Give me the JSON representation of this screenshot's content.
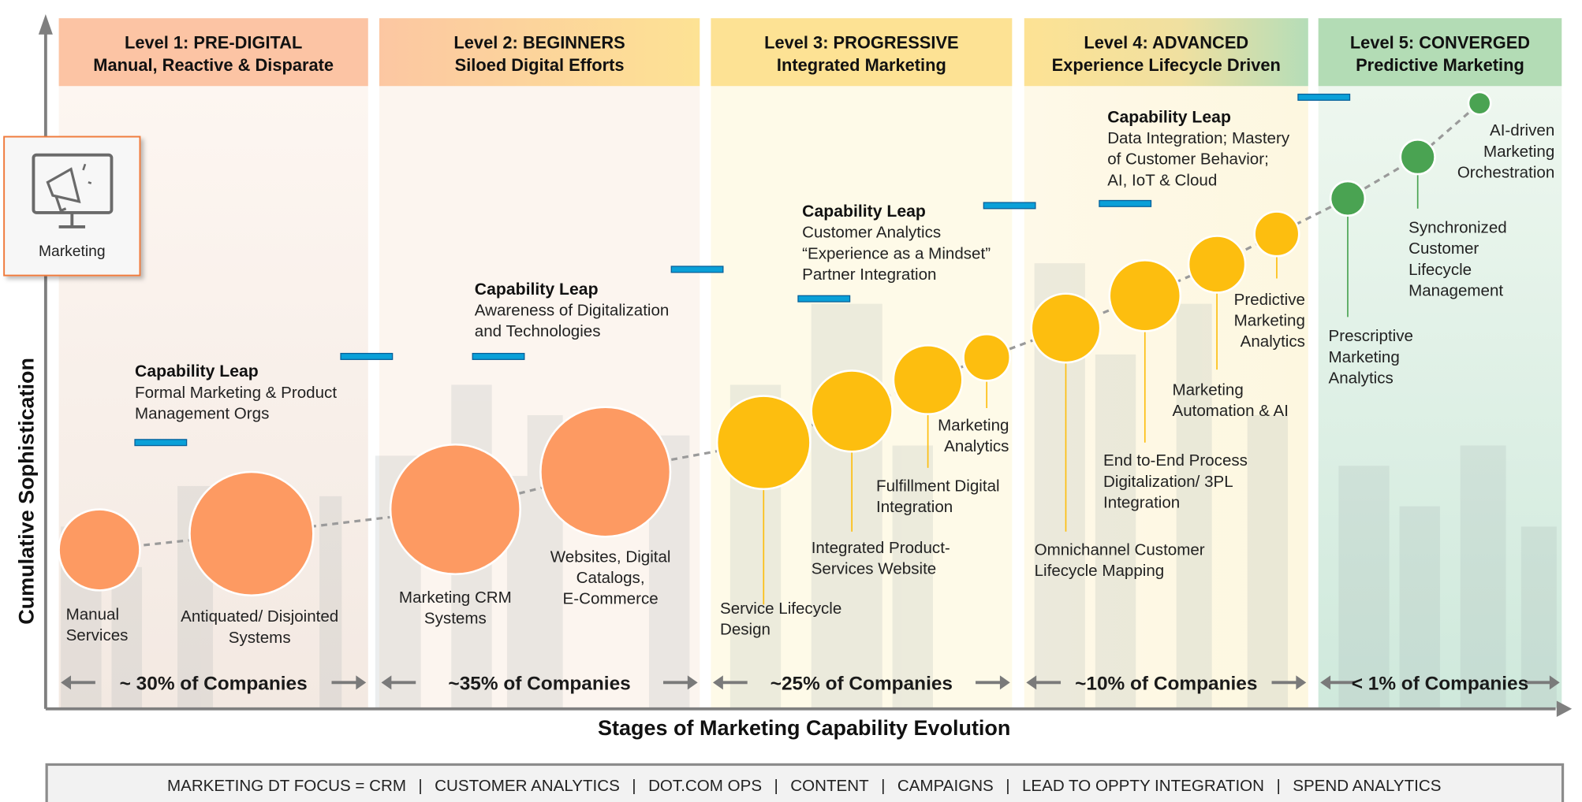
{
  "axes": {
    "y_label": "Cumulative Sophistication",
    "x_label": "Stages of Marketing Capability Evolution"
  },
  "marketing_card": {
    "label": "Marketing",
    "icon": "megaphone-monitor-icon"
  },
  "levels": [
    {
      "title": "Level 1: PRE-DIGITAL",
      "subtitle": "Manual, Reactive & Disparate",
      "share": "~ 30% of Companies"
    },
    {
      "title": "Level 2: BEGINNERS",
      "subtitle": "Siloed Digital Efforts",
      "share": "~35% of Companies"
    },
    {
      "title": "Level 3: PROGRESSIVE",
      "subtitle": "Integrated Marketing",
      "share": "~25% of Companies"
    },
    {
      "title": "Level 4: ADVANCED",
      "subtitle": "Experience Lifecycle Driven",
      "share": "~10% of Companies"
    },
    {
      "title": "Level 5: CONVERGED",
      "subtitle": "Predictive Marketing",
      "share": "< 1% of Companies"
    }
  ],
  "capability_leaps": [
    {
      "title": "Capability Leap",
      "lines": [
        "Formal Marketing & Product",
        "Management Orgs"
      ]
    },
    {
      "title": "Capability Leap",
      "lines": [
        "Awareness of Digitalization",
        "and Technologies"
      ]
    },
    {
      "title": "Capability Leap",
      "lines": [
        "Customer Analytics",
        "“Experience as a Mindset”",
        "Partner Integration"
      ]
    },
    {
      "title": "Capability Leap",
      "lines": [
        "Data Integration; Mastery",
        "of Customer Behavior;",
        "AI, IoT & Cloud"
      ]
    }
  ],
  "milestones": [
    {
      "lines": [
        "Manual",
        "Services"
      ],
      "level": 1
    },
    {
      "lines": [
        "Antiquated/ Disjointed",
        "Systems"
      ],
      "level": 1
    },
    {
      "lines": [
        "Marketing CRM",
        "Systems"
      ],
      "level": 2
    },
    {
      "lines": [
        "Websites, Digital",
        "Catalogs,",
        "E-Commerce"
      ],
      "level": 2
    },
    {
      "lines": [
        "Service Lifecycle",
        "Design"
      ],
      "level": 3
    },
    {
      "lines": [
        "Integrated Product-",
        "Services Website"
      ],
      "level": 3
    },
    {
      "lines": [
        "Fulfillment Digital",
        "Integration"
      ],
      "level": 3
    },
    {
      "lines": [
        "Marketing",
        "Analytics"
      ],
      "level": 3
    },
    {
      "lines": [
        "Omnichannel Customer",
        "Lifecycle Mapping"
      ],
      "level": 4
    },
    {
      "lines": [
        "End to-End Process",
        "Digitalization/ 3PL",
        "Integration"
      ],
      "level": 4
    },
    {
      "lines": [
        "Marketing",
        "Automation & AI"
      ],
      "level": 4
    },
    {
      "lines": [
        "Predictive",
        "Marketing",
        "Analytics"
      ],
      "level": 4
    },
    {
      "lines": [
        "Prescriptive",
        "Marketing",
        "Analytics"
      ],
      "level": 5
    },
    {
      "lines": [
        "Synchronized",
        "Customer",
        "Lifecycle",
        "Management"
      ],
      "level": 5
    },
    {
      "lines": [
        "AI-driven",
        "Marketing",
        "Orchestration"
      ],
      "level": 5
    }
  ],
  "focus_bar": {
    "items": [
      "MARKETING DT FOCUS = CRM",
      "CUSTOMER ANALYTICS",
      "DOT.COM OPS",
      "CONTENT",
      "CAMPAIGNS",
      "LEAD TO OPPTY INTEGRATION",
      "SPEND ANALYTICS"
    ],
    "separator": "|"
  },
  "colors": {
    "level1": "#fd9a62",
    "level2": "#fd9a62",
    "level3": "#fdbe0f",
    "level4": "#fdbe0f",
    "level5": "#4aa352",
    "leap_bar": "#0aa0d8",
    "card_border": "#f07a3a"
  }
}
